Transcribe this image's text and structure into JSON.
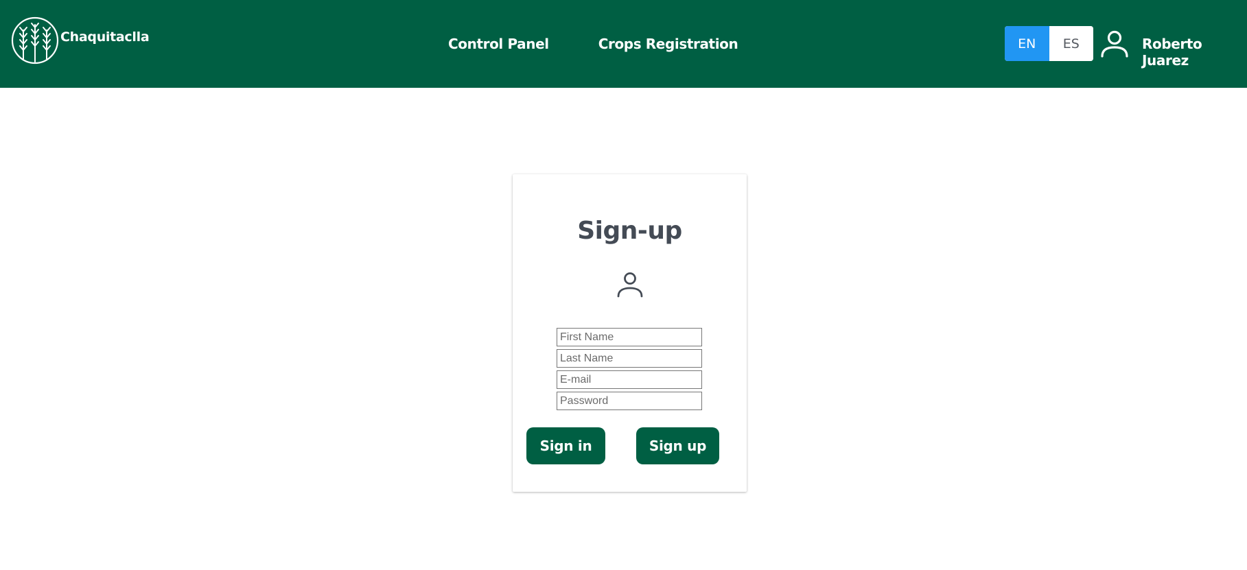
{
  "brand": {
    "name": "Chaquitaclla"
  },
  "nav": {
    "control_panel": "Control Panel",
    "crops_registration": "Crops Registration"
  },
  "language": {
    "en": "EN",
    "es": "ES",
    "active": "EN"
  },
  "user": {
    "name": "Roberto Juarez"
  },
  "signup": {
    "title": "Sign-up",
    "first_name_placeholder": "First Name",
    "last_name_placeholder": "Last Name",
    "email_placeholder": "E-mail",
    "password_placeholder": "Password",
    "signin_label": "Sign in",
    "signup_label": "Sign up"
  },
  "colors": {
    "header": "#005f43",
    "accent": "#2196f3",
    "button": "#005f43",
    "title": "#444b55"
  },
  "icons": {
    "logo": "wheat-logo-icon",
    "user": "user-icon",
    "avatar": "user-avatar-icon"
  }
}
